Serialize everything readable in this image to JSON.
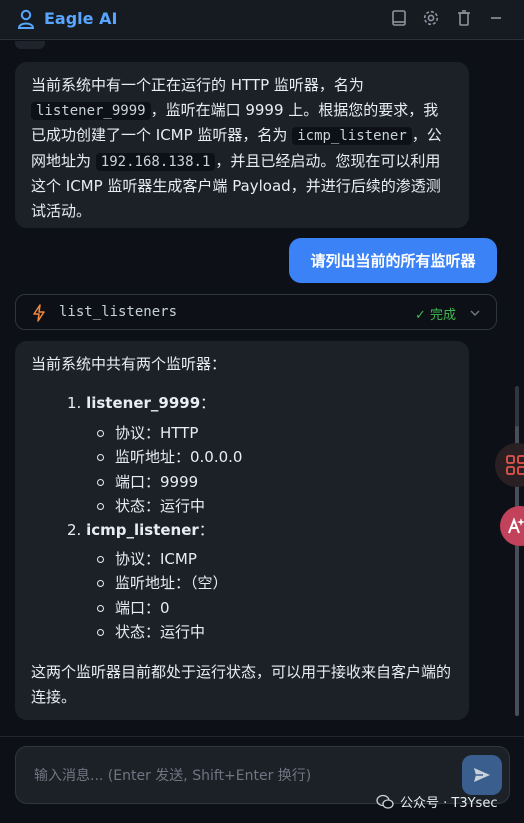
{
  "header": {
    "title": "Eagle AI"
  },
  "messages": {
    "ai_reply_1": {
      "p1": "当前系统中有一个正在运行的 HTTP 监听器，名为",
      "code1": "listener_9999",
      "p2": "，监听在端口 9999 上。根据您的要求，我已成功创建了一个 ICMP 监听器，名为",
      "code2": "icmp_listener",
      "p3": "，公网地址为",
      "code3": "192.168.138.1",
      "p4": "，并且已经启动。您现在可以利用这个 ICMP 监听器生成客户端 Payload，并进行后续的渗透测试活动。"
    },
    "user_msg": "请列出当前的所有监听器",
    "tool_call": {
      "name": "list_listeners",
      "status": "✓ 完成"
    },
    "ai_reply_2": {
      "intro": "当前系统中共有两个监听器：",
      "listeners": [
        {
          "num": "1.",
          "name": "listener_9999",
          "colon": "：",
          "details": [
            "协议：HTTP",
            "监听地址：0.0.0.0",
            "端口：9999",
            "状态：运行中"
          ]
        },
        {
          "num": "2.",
          "name": "icmp_listener",
          "colon": "：",
          "details": [
            "协议：ICMP",
            "监听地址：（空）",
            "端口：0",
            "状态：运行中"
          ]
        }
      ],
      "summary": "这两个监听器目前都处于运行状态，可以用于接收来自客户端的连接。"
    }
  },
  "composer": {
    "placeholder": "输入消息... (Enter 发送, Shift+Enter 换行)"
  },
  "watermark": "公众号 · T3Ysec",
  "colors": {
    "accent": "#3b82f6",
    "title": "#58a6ff",
    "success": "#3fb950",
    "bolt": "#f0883e"
  },
  "icons": [
    "user-icon",
    "book-icon",
    "gear-icon",
    "trash-icon",
    "minimize-icon",
    "bolt-icon",
    "chevron-down-icon",
    "send-icon",
    "grid-icon",
    "translate-icon",
    "wechat-icon"
  ]
}
